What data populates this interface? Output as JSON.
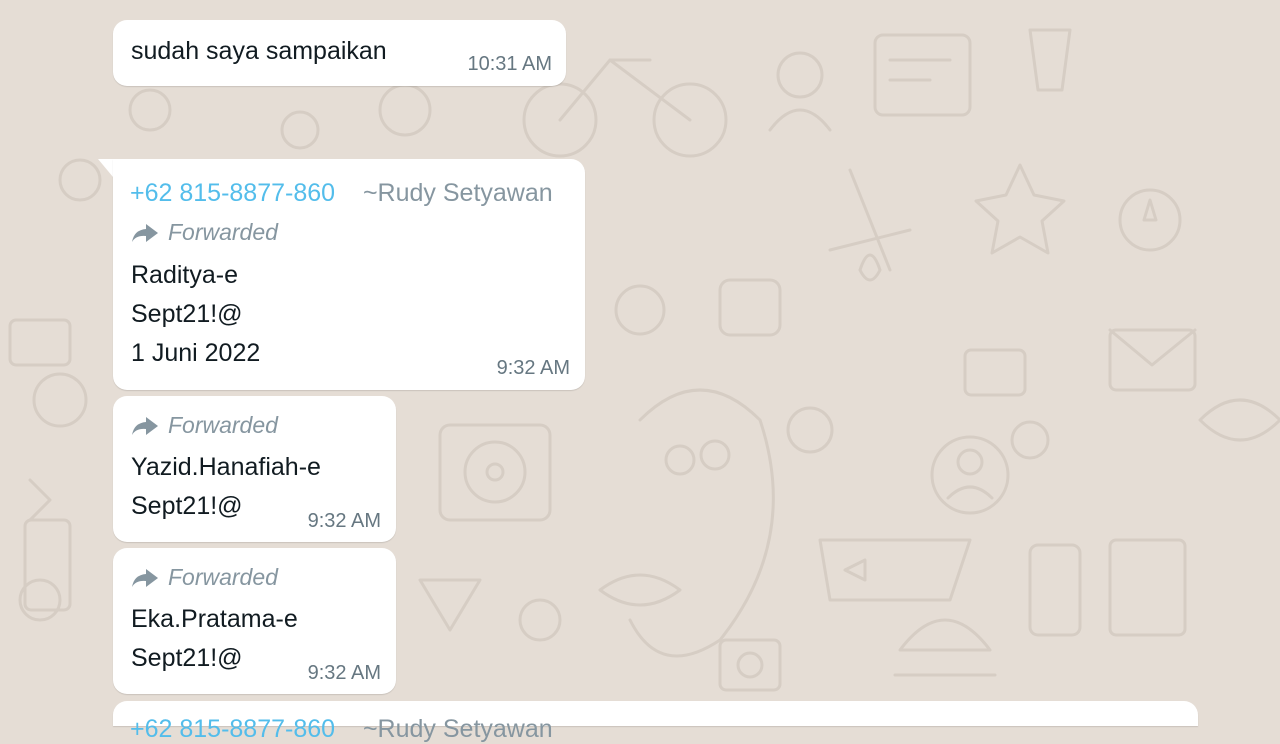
{
  "chat": {
    "messages": [
      {
        "text": "sudah saya sampaikan",
        "time": "10:31 AM"
      },
      {
        "sender_phone": "+62 815-8877-860",
        "sender_name": "~Rudy Setyawan",
        "forwarded_label": "Forwarded",
        "lines": [
          "Raditya-e",
          "Sept21!@",
          "1 Juni 2022"
        ],
        "time": "9:32 AM"
      },
      {
        "forwarded_label": "Forwarded",
        "lines": [
          "Yazid.Hanafiah-e",
          "Sept21!@"
        ],
        "time": "9:32 AM"
      },
      {
        "forwarded_label": "Forwarded",
        "lines": [
          "Eka.Pratama-e",
          "Sept21!@"
        ],
        "time": "9:32 AM"
      },
      {
        "sender_phone": "+62 815-8877-860",
        "sender_name": "~Rudy Setyawan"
      }
    ]
  },
  "icons": {
    "forward": "forward-arrow-icon"
  },
  "colors": {
    "wallpaper": "#e5ddd5",
    "bubble": "#ffffff",
    "sender_phone": "#53bdeb",
    "meta_text": "#8696a0"
  }
}
